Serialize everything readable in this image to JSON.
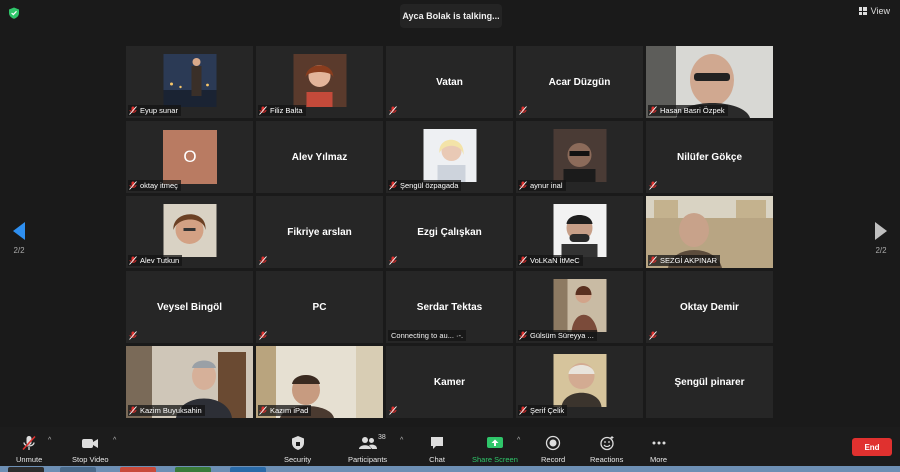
{
  "top": {
    "talking": "Ayca Bolak is talking...",
    "view_label": "View"
  },
  "pager": {
    "left": "2/2",
    "right": "2/2"
  },
  "tiles": [
    {
      "name": "Eyup sunar",
      "type": "photo"
    },
    {
      "name": "Filiz Balta",
      "type": "photo"
    },
    {
      "name": "Vatan",
      "type": "name"
    },
    {
      "name": "Acar Düzgün",
      "type": "name"
    },
    {
      "name": "Hasan Basri Özpek",
      "type": "video"
    },
    {
      "name": "oktay itmeç",
      "type": "avatar",
      "initial": "O"
    },
    {
      "name": "Alev Yılmaz",
      "type": "name"
    },
    {
      "name": "Şengül özpagada",
      "type": "photo"
    },
    {
      "name": "aynur inal",
      "type": "photo"
    },
    {
      "name": "Nilüfer Gökçe",
      "type": "name"
    },
    {
      "name": "Alev Tutkun",
      "type": "photo"
    },
    {
      "name": "Fikriye arslan",
      "type": "name"
    },
    {
      "name": "Ezgi Çalışkan",
      "type": "name"
    },
    {
      "name": "VoLKaN İtMeC",
      "type": "photo"
    },
    {
      "name": "SEZGİ AKPINAR",
      "type": "video"
    },
    {
      "name": "Veysel Bingöl",
      "type": "name"
    },
    {
      "name": "PC",
      "type": "name"
    },
    {
      "name": "Serdar Tektas",
      "type": "name",
      "status": "Connecting to au... ·-."
    },
    {
      "name": "Gülsüm Süreyya ...",
      "type": "photo"
    },
    {
      "name": "Oktay Demir",
      "type": "name"
    },
    {
      "name": "Kazim Buyuksahin",
      "type": "video"
    },
    {
      "name": "Kazım iPad",
      "type": "video"
    },
    {
      "name": "Kamer",
      "type": "name"
    },
    {
      "name": "Şerif Çelik",
      "type": "photo"
    },
    {
      "name": "Şengül pinarer",
      "type": "name"
    }
  ],
  "toolbar": {
    "unmute": "Unmute",
    "stop_video": "Stop Video",
    "security": "Security",
    "participants": "Participants",
    "participants_count": "38",
    "chat": "Chat",
    "share_screen": "Share Screen",
    "record": "Record",
    "reactions": "Reactions",
    "more": "More",
    "end": "End"
  },
  "colors": {
    "share_green": "#2fc66a",
    "end_red": "#e0312f",
    "mic_off_red": "#e0312f",
    "shield_green": "#2fc66a",
    "pager_blue": "#2e8ff0"
  }
}
